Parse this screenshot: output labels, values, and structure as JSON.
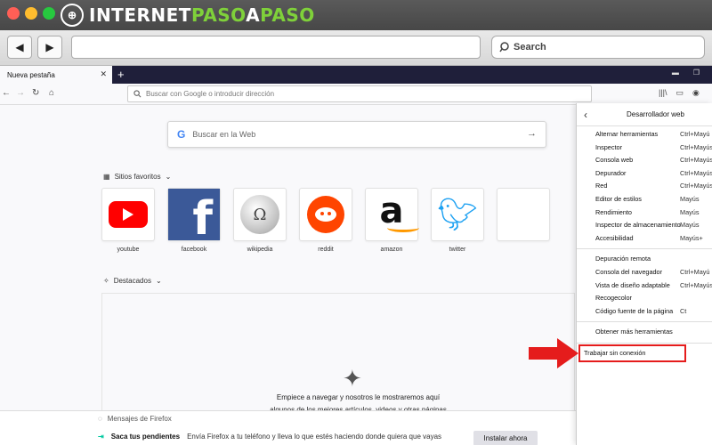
{
  "site_brand": {
    "part1": "INTERNET",
    "part2": "PASO",
    "part3": "A",
    "part4": "PASO",
    "logo_letter": "⊕"
  },
  "mac_toolbar": {
    "back_icon": "◀",
    "forward_icon": "▶",
    "search_placeholder": "Search"
  },
  "firefox": {
    "tab_title": "Nueva pestaña",
    "tab_close": "✕",
    "new_tab": "+",
    "url_placeholder": "Buscar con Google o introducir dirección"
  },
  "newtab": {
    "search_placeholder": "Buscar en la Web",
    "search_logo": "G",
    "top_sites_heading": "Sitios favoritos",
    "top_sites": [
      {
        "label": "youtube",
        "icon": "youtube-icon"
      },
      {
        "label": "facebook",
        "icon": "facebook-icon"
      },
      {
        "label": "wikipedia",
        "icon": "wikipedia-icon"
      },
      {
        "label": "reddit",
        "icon": "reddit-icon"
      },
      {
        "label": "amazon",
        "icon": "amazon-icon"
      },
      {
        "label": "twitter",
        "icon": "twitter-icon"
      }
    ],
    "highlights_heading": "Destacados",
    "empty_line1": "Empiece a navegar y nosotros le mostraremos aquí",
    "empty_line2": "algunos de los mejores artículos, videos y otras páginas",
    "messages_title": "Mensajes de Firefox",
    "message_bold": "Saca tus pendientes",
    "message_text": "Envía Firefox a tu teléfono y lleva lo que estés haciendo donde quiera que vayas",
    "install_button": "Instalar ahora"
  },
  "dev_menu": {
    "title": "Desarrollador web",
    "group1": [
      {
        "label": "Alternar herramientas",
        "shortcut": "Ctrl+Mayú"
      },
      {
        "label": "Inspector",
        "shortcut": "Ctrl+Mayús"
      },
      {
        "label": "Consola web",
        "shortcut": "Ctrl+Mayús"
      },
      {
        "label": "Depurador",
        "shortcut": "Ctrl+Mayús"
      },
      {
        "label": "Red",
        "shortcut": "Ctrl+Mayús"
      },
      {
        "label": "Editor de estilos",
        "shortcut": "Mayús"
      },
      {
        "label": "Rendimiento",
        "shortcut": "Mayús"
      },
      {
        "label": "Inspector de almacenamiento",
        "shortcut": "Mayús"
      },
      {
        "label": "Accesibilidad",
        "shortcut": "Mayús+"
      }
    ],
    "group2": [
      {
        "label": "Depuración remota",
        "shortcut": ""
      },
      {
        "label": "Consola del navegador",
        "shortcut": "Ctrl+Mayú"
      },
      {
        "label": "Vista de diseño adaptable",
        "shortcut": "Ctrl+Mayús"
      },
      {
        "label": "Recogecolor",
        "shortcut": ""
      },
      {
        "label": "Código fuente de la página",
        "shortcut": "Ct"
      }
    ],
    "group3": [
      {
        "label": "Obtener más herramientas",
        "shortcut": ""
      }
    ],
    "group4": [
      {
        "label": "Trabajar sin conexión",
        "shortcut": ""
      }
    ]
  },
  "colors": {
    "highlight": "#e51c1c",
    "tab_strip": "#1f1f3a"
  }
}
